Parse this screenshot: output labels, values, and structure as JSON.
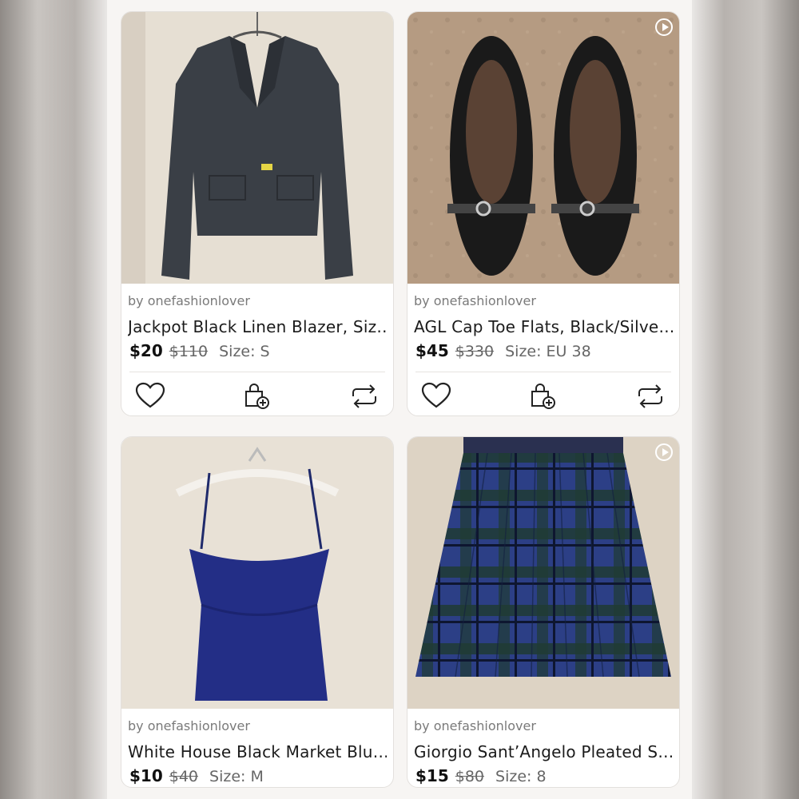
{
  "listings": [
    {
      "seller": "by onefashionlover",
      "title": "Jackpot Black Linen Blazer, Siz…",
      "price": "$20",
      "original_price": "$110",
      "size": "Size: S",
      "has_video": false,
      "photo_icon": "blazer-photo"
    },
    {
      "seller": "by onefashionlover",
      "title": "AGL Cap Toe Flats, Black/Silve…",
      "price": "$45",
      "original_price": "$330",
      "size": "Size: EU 38",
      "has_video": true,
      "photo_icon": "flats-photo"
    },
    {
      "seller": "by onefashionlover",
      "title": "White House Black Market Blu…",
      "price": "$10",
      "original_price": "$40",
      "size": "Size: M",
      "has_video": false,
      "photo_icon": "camisole-photo"
    },
    {
      "seller": "by onefashionlover",
      "title": "Giorgio Sant’Angelo Pleated S…",
      "price": "$15",
      "original_price": "$80",
      "size": "Size: 8",
      "has_video": true,
      "photo_icon": "skirt-photo"
    }
  ],
  "action_icons": [
    "heart-icon",
    "bag-add-icon",
    "share-repost-icon"
  ],
  "colors": {
    "screen_bg": "#f7f5f3",
    "card_bg": "#ffffff",
    "text_primary": "#1b1b1b",
    "text_secondary": "#7a7a7a"
  }
}
